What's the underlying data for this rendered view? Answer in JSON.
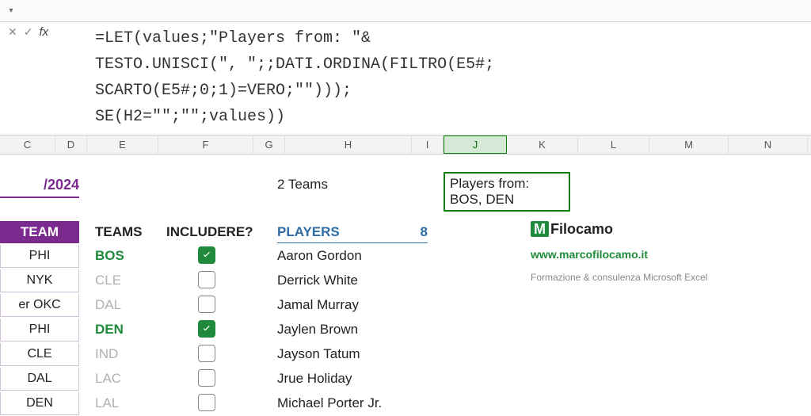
{
  "toolbar": {
    "dropdown_glyph": "▾"
  },
  "formula": "=LET(values;\"Players from: \"&\nTESTO.UNISCI(\", \";;DATI.ORDINA(FILTRO(E5#;\nSCARTO(E5#;0;1)=VERO;\"\")));\nSE(H2=\"\";\"\";values))",
  "columns": [
    "C",
    "D",
    "E",
    "F",
    "G",
    "H",
    "I",
    "J",
    "K",
    "L",
    "M",
    "N"
  ],
  "date_text": "/2024",
  "teams_header": "TEAM",
  "team_col": [
    "PHI",
    "NYK",
    "er OKC",
    "PHI",
    "CLE",
    "DAL",
    "DEN"
  ],
  "filter": {
    "header_teams": "TEAMS",
    "header_include": "INCLUDERE?",
    "rows": [
      {
        "team": "BOS",
        "checked": true
      },
      {
        "team": "CLE",
        "checked": false
      },
      {
        "team": "DAL",
        "checked": false
      },
      {
        "team": "DEN",
        "checked": true
      },
      {
        "team": "IND",
        "checked": false
      },
      {
        "team": "LAC",
        "checked": false
      },
      {
        "team": "LAL",
        "checked": false
      }
    ]
  },
  "summary_teams": "2 Teams",
  "players_header": "PLAYERS",
  "players_count": "8",
  "players": [
    "Aaron Gordon",
    "Derrick White",
    "Jamal Murray",
    "Jaylen Brown",
    "Jayson Tatum",
    "Jrue Holiday",
    "Michael Porter Jr."
  ],
  "selected_text": "Players from: BOS, DEN",
  "brand": {
    "m": "M",
    "name": "Filocamo",
    "url": "www.marcofilocamo.it",
    "sub": "Formazione & consulenza Microsoft Excel"
  }
}
